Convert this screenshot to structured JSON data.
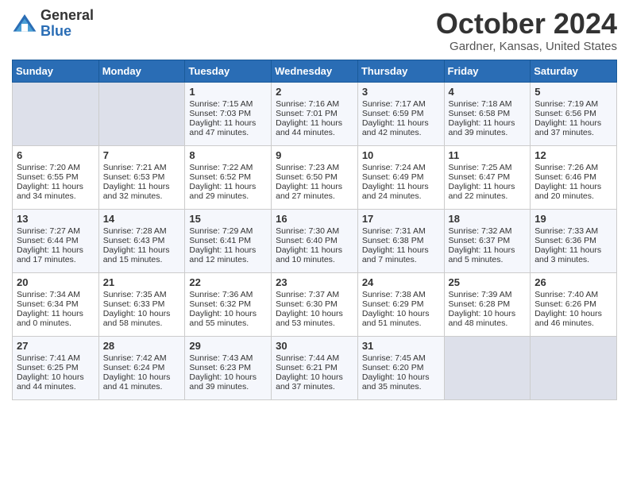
{
  "header": {
    "logo_general": "General",
    "logo_blue": "Blue",
    "title": "October 2024",
    "location": "Gardner, Kansas, United States"
  },
  "days_of_week": [
    "Sunday",
    "Monday",
    "Tuesday",
    "Wednesday",
    "Thursday",
    "Friday",
    "Saturday"
  ],
  "weeks": [
    [
      {
        "day": "",
        "empty": true
      },
      {
        "day": "",
        "empty": true
      },
      {
        "day": "1",
        "sunrise": "7:15 AM",
        "sunset": "7:03 PM",
        "daylight": "11 hours and 47 minutes."
      },
      {
        "day": "2",
        "sunrise": "7:16 AM",
        "sunset": "7:01 PM",
        "daylight": "11 hours and 44 minutes."
      },
      {
        "day": "3",
        "sunrise": "7:17 AM",
        "sunset": "6:59 PM",
        "daylight": "11 hours and 42 minutes."
      },
      {
        "day": "4",
        "sunrise": "7:18 AM",
        "sunset": "6:58 PM",
        "daylight": "11 hours and 39 minutes."
      },
      {
        "day": "5",
        "sunrise": "7:19 AM",
        "sunset": "6:56 PM",
        "daylight": "11 hours and 37 minutes."
      }
    ],
    [
      {
        "day": "6",
        "sunrise": "7:20 AM",
        "sunset": "6:55 PM",
        "daylight": "11 hours and 34 minutes."
      },
      {
        "day": "7",
        "sunrise": "7:21 AM",
        "sunset": "6:53 PM",
        "daylight": "11 hours and 32 minutes."
      },
      {
        "day": "8",
        "sunrise": "7:22 AM",
        "sunset": "6:52 PM",
        "daylight": "11 hours and 29 minutes."
      },
      {
        "day": "9",
        "sunrise": "7:23 AM",
        "sunset": "6:50 PM",
        "daylight": "11 hours and 27 minutes."
      },
      {
        "day": "10",
        "sunrise": "7:24 AM",
        "sunset": "6:49 PM",
        "daylight": "11 hours and 24 minutes."
      },
      {
        "day": "11",
        "sunrise": "7:25 AM",
        "sunset": "6:47 PM",
        "daylight": "11 hours and 22 minutes."
      },
      {
        "day": "12",
        "sunrise": "7:26 AM",
        "sunset": "6:46 PM",
        "daylight": "11 hours and 20 minutes."
      }
    ],
    [
      {
        "day": "13",
        "sunrise": "7:27 AM",
        "sunset": "6:44 PM",
        "daylight": "11 hours and 17 minutes."
      },
      {
        "day": "14",
        "sunrise": "7:28 AM",
        "sunset": "6:43 PM",
        "daylight": "11 hours and 15 minutes."
      },
      {
        "day": "15",
        "sunrise": "7:29 AM",
        "sunset": "6:41 PM",
        "daylight": "11 hours and 12 minutes."
      },
      {
        "day": "16",
        "sunrise": "7:30 AM",
        "sunset": "6:40 PM",
        "daylight": "11 hours and 10 minutes."
      },
      {
        "day": "17",
        "sunrise": "7:31 AM",
        "sunset": "6:38 PM",
        "daylight": "11 hours and 7 minutes."
      },
      {
        "day": "18",
        "sunrise": "7:32 AM",
        "sunset": "6:37 PM",
        "daylight": "11 hours and 5 minutes."
      },
      {
        "day": "19",
        "sunrise": "7:33 AM",
        "sunset": "6:36 PM",
        "daylight": "11 hours and 3 minutes."
      }
    ],
    [
      {
        "day": "20",
        "sunrise": "7:34 AM",
        "sunset": "6:34 PM",
        "daylight": "11 hours and 0 minutes."
      },
      {
        "day": "21",
        "sunrise": "7:35 AM",
        "sunset": "6:33 PM",
        "daylight": "10 hours and 58 minutes."
      },
      {
        "day": "22",
        "sunrise": "7:36 AM",
        "sunset": "6:32 PM",
        "daylight": "10 hours and 55 minutes."
      },
      {
        "day": "23",
        "sunrise": "7:37 AM",
        "sunset": "6:30 PM",
        "daylight": "10 hours and 53 minutes."
      },
      {
        "day": "24",
        "sunrise": "7:38 AM",
        "sunset": "6:29 PM",
        "daylight": "10 hours and 51 minutes."
      },
      {
        "day": "25",
        "sunrise": "7:39 AM",
        "sunset": "6:28 PM",
        "daylight": "10 hours and 48 minutes."
      },
      {
        "day": "26",
        "sunrise": "7:40 AM",
        "sunset": "6:26 PM",
        "daylight": "10 hours and 46 minutes."
      }
    ],
    [
      {
        "day": "27",
        "sunrise": "7:41 AM",
        "sunset": "6:25 PM",
        "daylight": "10 hours and 44 minutes."
      },
      {
        "day": "28",
        "sunrise": "7:42 AM",
        "sunset": "6:24 PM",
        "daylight": "10 hours and 41 minutes."
      },
      {
        "day": "29",
        "sunrise": "7:43 AM",
        "sunset": "6:23 PM",
        "daylight": "10 hours and 39 minutes."
      },
      {
        "day": "30",
        "sunrise": "7:44 AM",
        "sunset": "6:21 PM",
        "daylight": "10 hours and 37 minutes."
      },
      {
        "day": "31",
        "sunrise": "7:45 AM",
        "sunset": "6:20 PM",
        "daylight": "10 hours and 35 minutes."
      },
      {
        "day": "",
        "empty": true
      },
      {
        "day": "",
        "empty": true
      }
    ]
  ],
  "labels": {
    "sunrise": "Sunrise:",
    "sunset": "Sunset:",
    "daylight": "Daylight:"
  }
}
